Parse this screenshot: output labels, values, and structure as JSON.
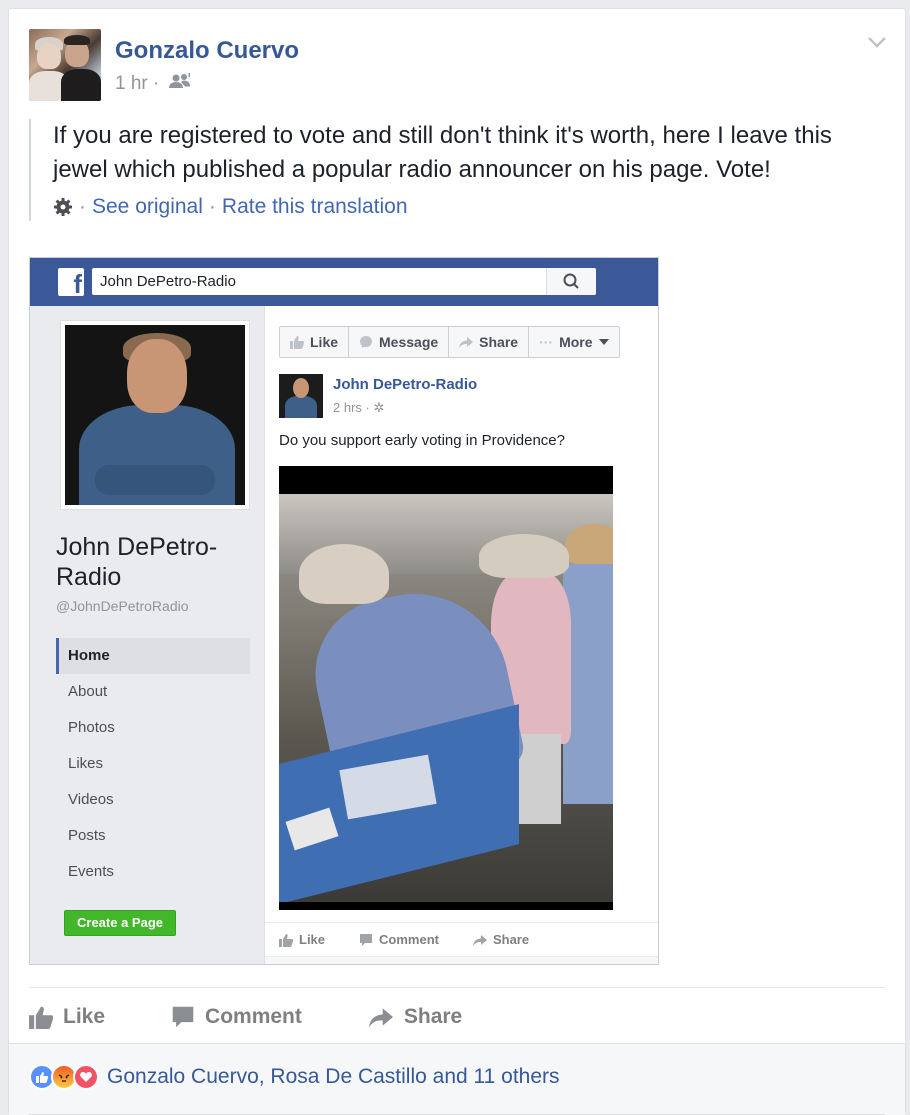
{
  "post": {
    "author": "Gonzalo Cuervo",
    "time": "1 hr",
    "separator": "·",
    "audience_icon": "friends-icon",
    "text": "If you are registered to vote and still don't think it's worth, here I leave this jewel which published a popular radio announcer on his page. Vote!",
    "translation": {
      "see_original": "See original",
      "rate": "Rate this translation",
      "dot": "·"
    }
  },
  "embedded": {
    "search_value": "John DePetro-Radio",
    "page_name": "John DePetro-Radio",
    "handle": "@JohnDePetroRadio",
    "nav": [
      {
        "label": "Home",
        "active": true
      },
      {
        "label": "About"
      },
      {
        "label": "Photos"
      },
      {
        "label": "Likes"
      },
      {
        "label": "Videos"
      },
      {
        "label": "Posts"
      },
      {
        "label": "Events"
      }
    ],
    "create_page": "Create a Page",
    "page_actions": {
      "like": "Like",
      "message": "Message",
      "share": "Share",
      "more": "More"
    },
    "post": {
      "name": "John DePetro-Radio",
      "time": "2 hrs",
      "dot": "·",
      "text": "Do you support early voting in Providence?"
    },
    "post_actions": {
      "like": "Like",
      "comment": "Comment",
      "share": "Share"
    }
  },
  "actions": {
    "like": "Like",
    "comment": "Comment",
    "share": "Share"
  },
  "reactions": {
    "summary": "Gonzalo Cuervo, Rosa De Castillo and 11 others",
    "icons": [
      "like-reaction-icon",
      "angry-reaction-icon",
      "love-reaction-icon"
    ]
  },
  "colors": {
    "link": "#365899",
    "fb_blue": "#3b5998",
    "create_green": "#42b72a"
  }
}
